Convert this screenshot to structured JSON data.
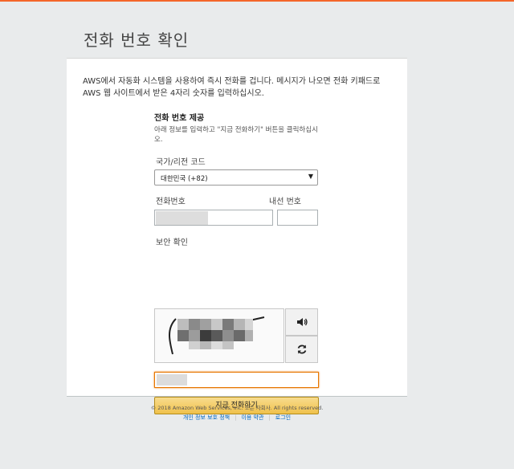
{
  "page": {
    "title": "전화 번호 확인",
    "intro": "AWS에서 자동화 시스템을 사용하여 즉시 전화를 겁니다. 메시지가 나오면 전화 키패드로 AWS 웹 사이트에서 받은 4자리 숫자를 입력하십시오.",
    "accent_color": "#f4662a"
  },
  "form": {
    "section_title": "전화 번호 제공",
    "help_text": "아래 정보를 입력하고 \"지금 전화하기\" 버튼을 클릭하십시오.",
    "country_label": "국가/리전 코드",
    "country_value": "대한민국 (+82)",
    "phone_label": "전화번호",
    "extension_label": "내선 번호",
    "security_label": "보안 확인",
    "submit_label": "지금 전화하기",
    "audio_icon": "speaker-icon",
    "refresh_icon": "refresh-icon"
  },
  "footer": {
    "copyright": "© 2018 Amazon Web Services, Inc. 또는 자회사. All rights reserved.",
    "links": [
      "개인 정보 보호 정책",
      "이용 약관",
      "로그인"
    ]
  }
}
